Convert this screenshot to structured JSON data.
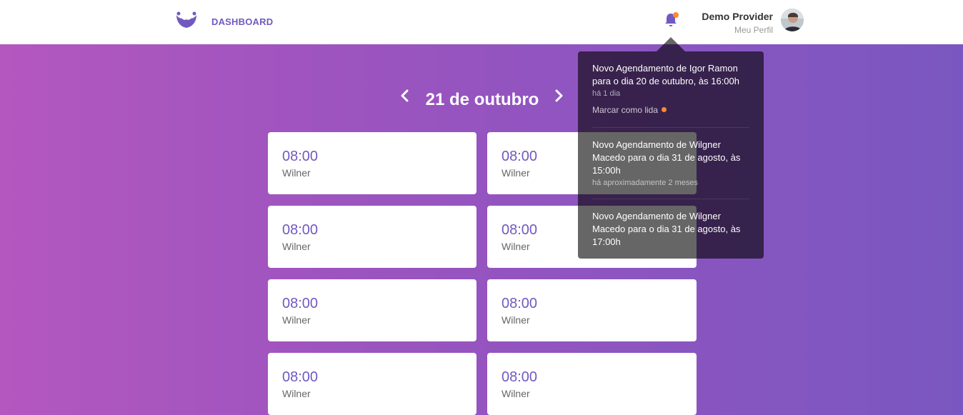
{
  "header": {
    "nav_label": "DASHBOARD",
    "profile_name": "Demo Provider",
    "profile_link": "Meu Perfil",
    "brand_color": "#7159c1",
    "unread_indicator_color": "#ff892e"
  },
  "schedule": {
    "date_label": "21 de outubro",
    "appointments": [
      {
        "time": "08:00",
        "name": "Wilner"
      },
      {
        "time": "08:00",
        "name": "Wilner"
      },
      {
        "time": "08:00",
        "name": "Wilner"
      },
      {
        "time": "08:00",
        "name": "Wilner"
      },
      {
        "time": "08:00",
        "name": "Wilner"
      },
      {
        "time": "08:00",
        "name": "Wilner"
      },
      {
        "time": "08:00",
        "name": "Wilner"
      },
      {
        "time": "08:00",
        "name": "Wilner"
      }
    ]
  },
  "notifications": {
    "items": [
      {
        "text": "Novo Agendamento de Igor Ramon para o dia 20 de  outubro, às 16:00h",
        "time": "há 1 dia",
        "action": "Marcar como lida"
      },
      {
        "text": "Novo Agendamento de Wilgner Macedo para o dia 31 de  agosto, às 15:00h",
        "time": "há aproximadamente 2 meses"
      },
      {
        "text": "Novo Agendamento de Wilgner Macedo para o dia 31 de  agosto, às 17:00h",
        "time": ""
      }
    ]
  },
  "icons": {
    "logo": "mustache-logo-icon",
    "bell": "bell-icon",
    "prev": "chevron-left-icon",
    "next": "chevron-right-icon"
  }
}
